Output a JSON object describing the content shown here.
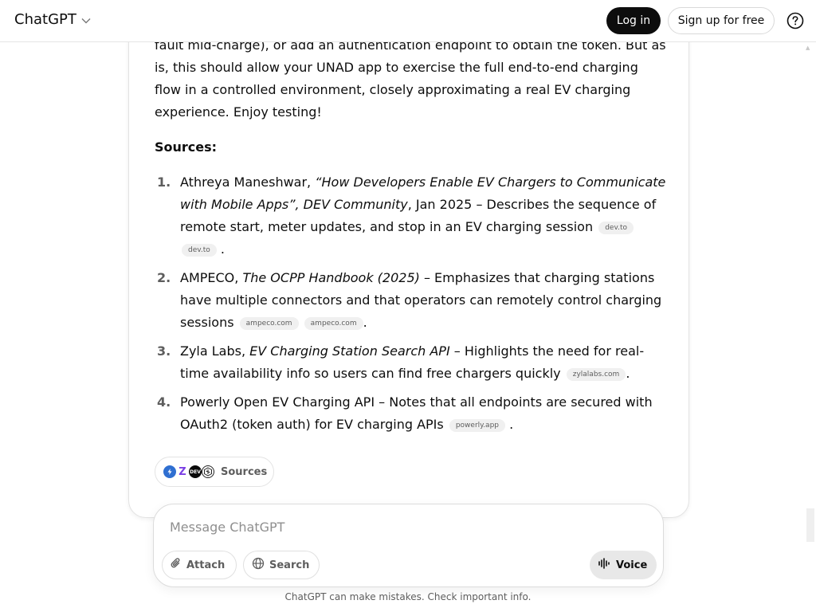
{
  "header": {
    "brand": "ChatGPT",
    "login": "Log in",
    "signup": "Sign up for free"
  },
  "message": {
    "intro_text": "fault mid-charge), or add an authentication endpoint to obtain the token. But as is, this should allow your UNAD app to exercise the full end-to-end charging flow in a controlled environment, closely approximating a real EV charging experience. Enjoy testing!",
    "sources_heading": "Sources:",
    "sources": [
      {
        "num": "1.",
        "author": "Athreya Maneshwar, ",
        "title": "“How Developers Enable EV Chargers to Communicate with Mobile Apps”, DEV Community",
        "rest": ", Jan 2025 – Describes the sequence of remote start, meter updates, and stop in an EV charging session",
        "chips": [
          "dev.to",
          "dev.to"
        ]
      },
      {
        "num": "2.",
        "author": "AMPECO, ",
        "title": "The OCPP Handbook (2025)",
        "rest": " – Emphasizes that charging stations have multiple connectors and that operators can remotely control charging sessions",
        "chips": [
          "ampeco.com",
          "ampeco.com"
        ]
      },
      {
        "num": "3.",
        "author": "Zyla Labs, ",
        "title": "EV Charging Station Search API",
        "rest": " – Highlights the need for real-time availability info so users can find free chargers quickly",
        "chips": [
          "zylalabs.com"
        ]
      },
      {
        "num": "4.",
        "author": "Powerly Open EV Charging API – Notes that all endpoints are secured with OAuth2 (token auth) for EV charging APIs",
        "title": "",
        "rest": "",
        "chips": [
          "powerly.app"
        ]
      }
    ],
    "sources_button": "Sources",
    "source_favicons": [
      "ampeco-favicon",
      "zylalabs-favicon",
      "dev-favicon",
      "powerly-favicon"
    ]
  },
  "composer": {
    "placeholder": "Message ChatGPT",
    "attach": "Attach",
    "search": "Search",
    "voice": "Voice"
  },
  "footer": {
    "note": "ChatGPT can make mistakes. Check important info."
  }
}
